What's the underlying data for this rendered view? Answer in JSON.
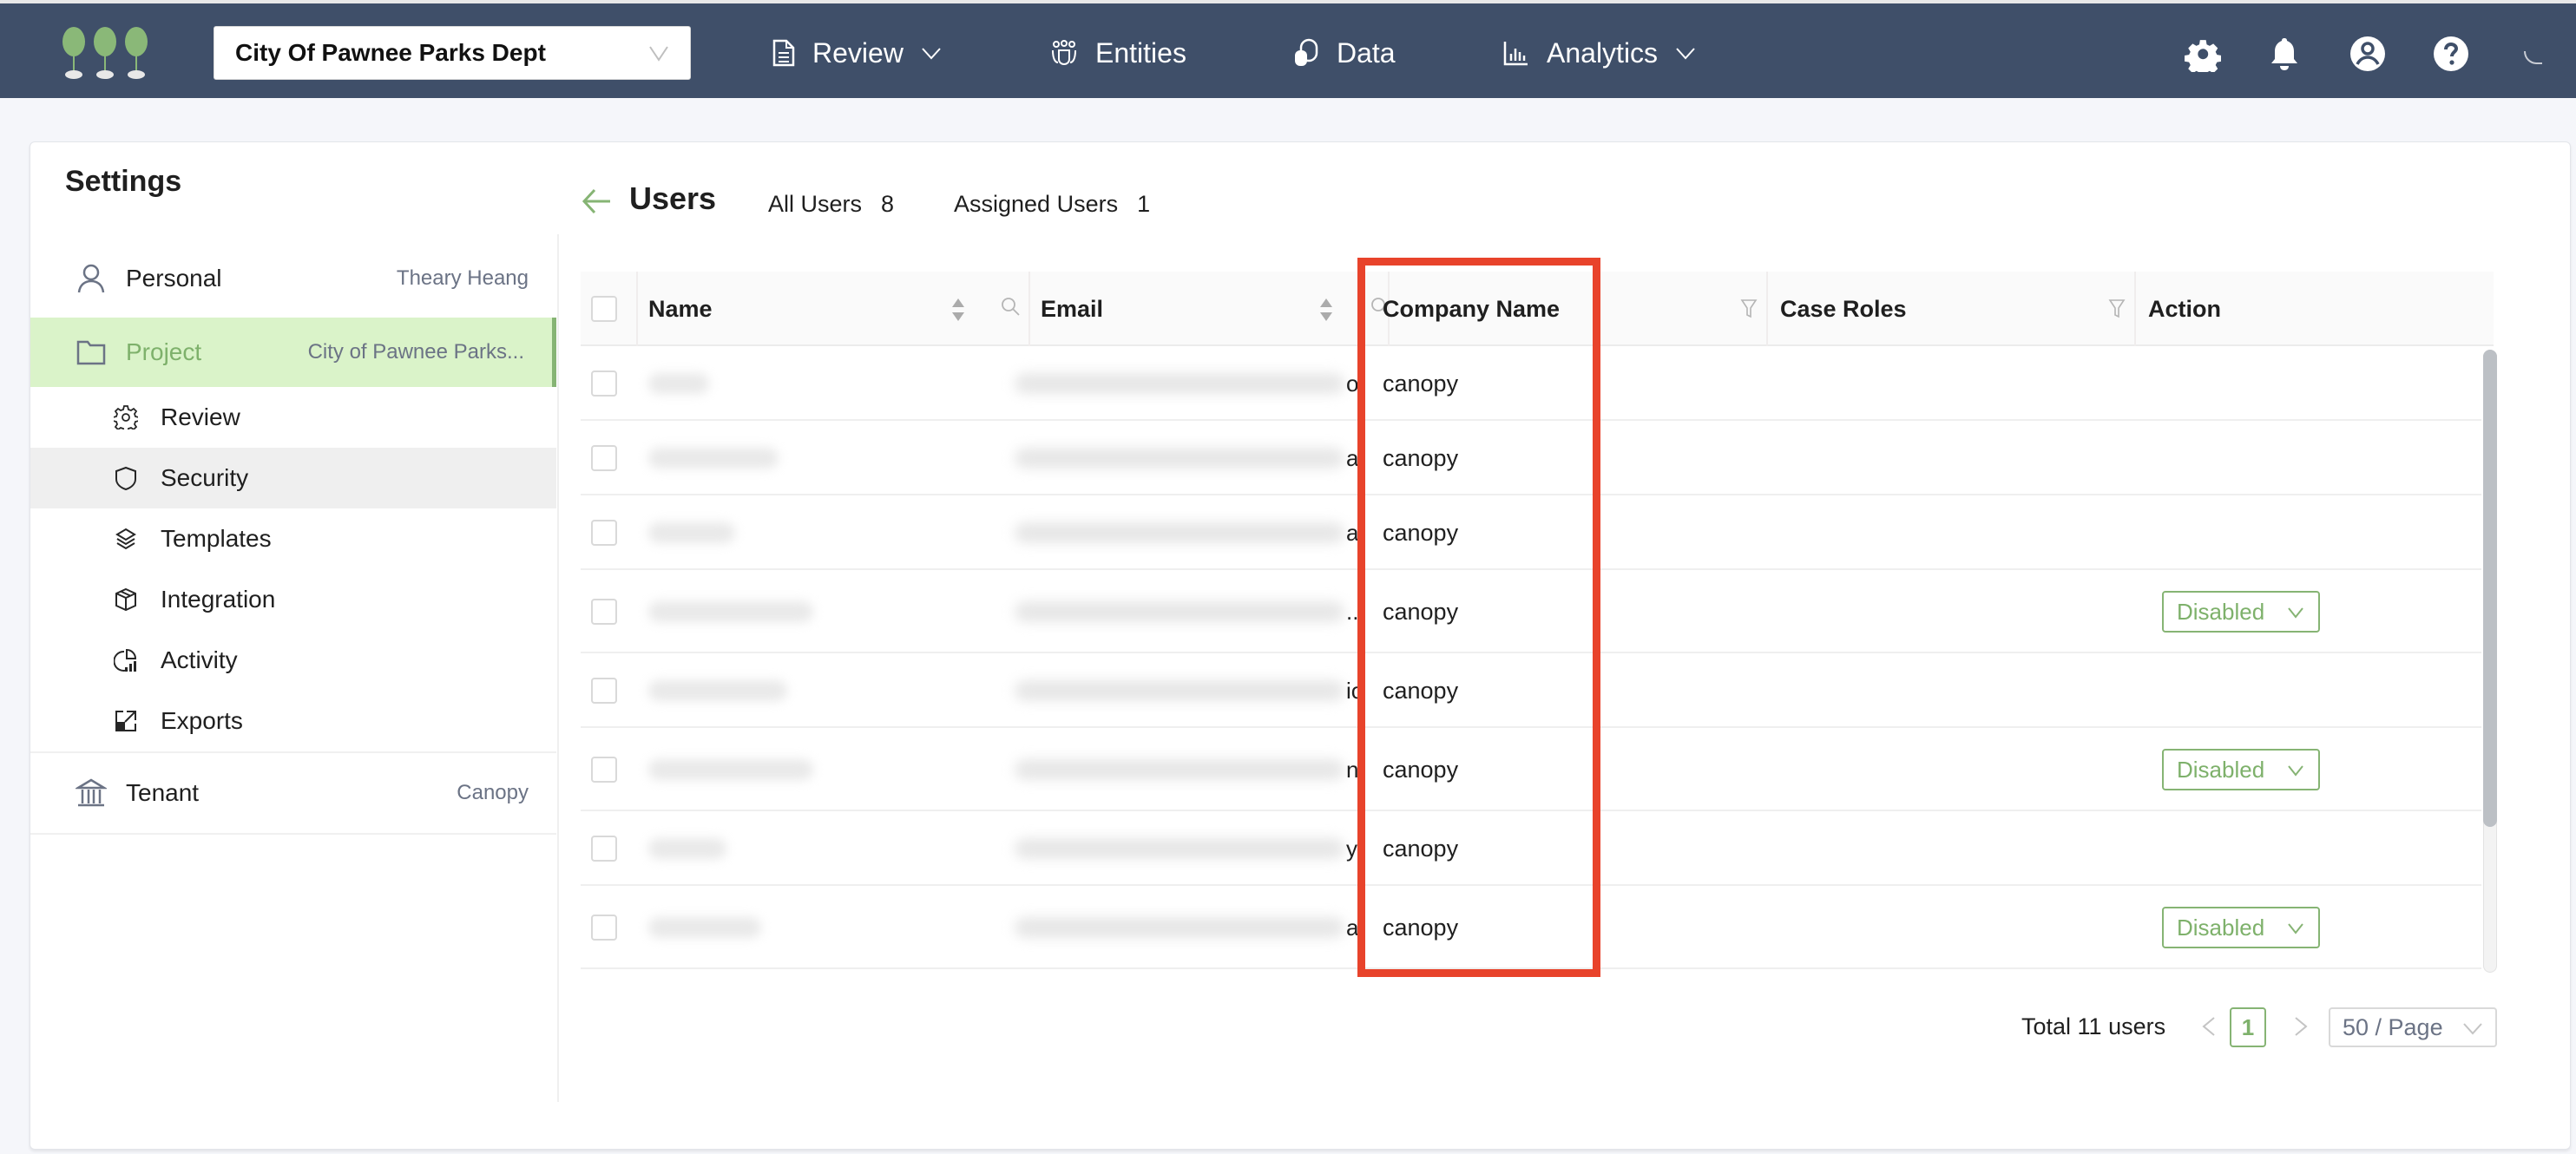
{
  "topbar": {
    "logo": "trees-logo-icon",
    "project_selector": {
      "value": "City Of Pawnee Parks Dept"
    },
    "nav": [
      {
        "label": "Review",
        "icon": "document-icon",
        "has_dropdown": true
      },
      {
        "label": "Entities",
        "icon": "people-group-icon",
        "has_dropdown": false
      },
      {
        "label": "Data",
        "icon": "database-icon",
        "has_dropdown": false
      },
      {
        "label": "Analytics",
        "icon": "bar-chart-icon",
        "has_dropdown": true
      }
    ],
    "icons": [
      "gear-icon",
      "bell-icon",
      "user-circle-icon",
      "help-icon",
      "loading-spinner-icon"
    ]
  },
  "sidebar": {
    "title": "Settings",
    "personal": {
      "label": "Personal",
      "value": "Theary Heang",
      "icon": "user-icon"
    },
    "project": {
      "label": "Project",
      "value": "City of Pawnee Parks...",
      "icon": "folder-icon"
    },
    "sub_items": [
      {
        "label": "Review",
        "icon": "gear-icon",
        "active": false
      },
      {
        "label": "Security",
        "icon": "shield-icon",
        "active": true
      },
      {
        "label": "Templates",
        "icon": "layers-icon",
        "active": false
      },
      {
        "label": "Integration",
        "icon": "box-icon",
        "active": false
      },
      {
        "label": "Activity",
        "icon": "pie-chart-icon",
        "active": false
      },
      {
        "label": "Exports",
        "icon": "export-icon",
        "active": false
      }
    ],
    "tenant": {
      "label": "Tenant",
      "value": "Canopy",
      "icon": "bank-icon"
    }
  },
  "users": {
    "title": "Users",
    "tabs": [
      {
        "label": "All Users",
        "count": "8"
      },
      {
        "label": "Assigned Users",
        "count": "1"
      }
    ],
    "columns": [
      "Name",
      "Email",
      "Company Name",
      "Case Roles",
      "Action"
    ],
    "rows": [
      {
        "email_tail": "o..",
        "company": "canopy",
        "case_roles": "",
        "action": ""
      },
      {
        "email_tail": "a...",
        "company": "canopy",
        "case_roles": "",
        "action": ""
      },
      {
        "email_tail": "a..",
        "company": "canopy",
        "case_roles": "",
        "action": ""
      },
      {
        "email_tail": "...",
        "company": "canopy",
        "case_roles": "",
        "action": "Disabled"
      },
      {
        "email_tail": "io",
        "company": "canopy",
        "case_roles": "",
        "action": ""
      },
      {
        "email_tail": "n..",
        "company": "canopy",
        "case_roles": "",
        "action": "Disabled"
      },
      {
        "email_tail": "y..",
        "company": "canopy",
        "case_roles": "",
        "action": ""
      },
      {
        "email_tail": "a..",
        "company": "canopy",
        "case_roles": "",
        "action": "Disabled"
      }
    ],
    "pagination": {
      "total_label": "Total 11 users",
      "current_page": "1",
      "page_size": "50 / Page"
    }
  },
  "colors": {
    "topbar": "#3f4f69",
    "accent_green": "#7eb16b",
    "active_bg": "#daf3c9",
    "highlight": "#e8432b"
  }
}
